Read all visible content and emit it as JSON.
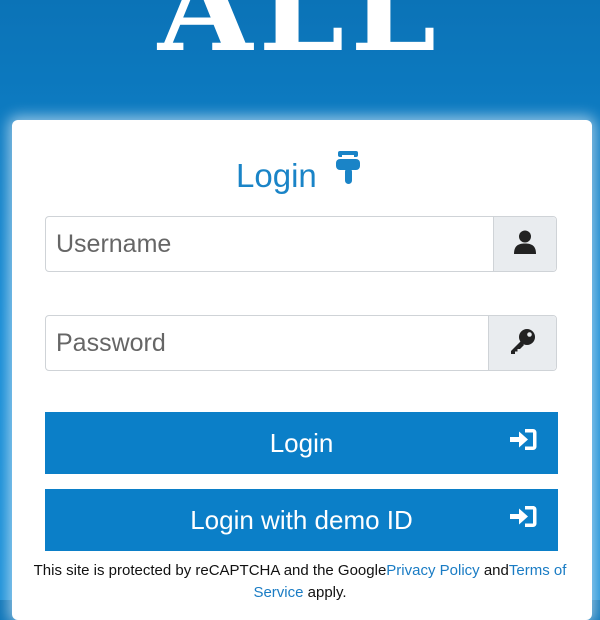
{
  "logo_text": "ALL",
  "login_title": "Login",
  "username": {
    "placeholder": "Username",
    "value": ""
  },
  "password": {
    "placeholder": "Password",
    "value": ""
  },
  "login_button": "Login",
  "demo_button": "Login with demo ID",
  "notice": {
    "prefix": "This site is protected by reCAPTCHA and the Google",
    "privacy_link": "Privacy Policy",
    "and_text": " and",
    "terms_link": "Terms of Service",
    "suffix": " apply."
  },
  "colors": {
    "primary": "#0b7fc8",
    "title": "#1a84c7",
    "background": "#0f7cc4"
  },
  "icons": {
    "title": "hand-pointing-down-icon",
    "username": "user-icon",
    "password": "key-icon",
    "login": "sign-in-icon",
    "demo": "sign-in-icon"
  }
}
